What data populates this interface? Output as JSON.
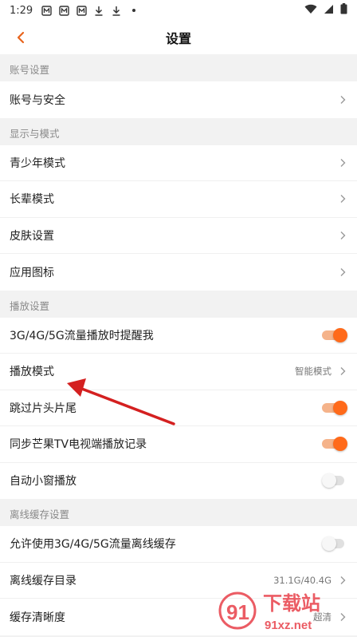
{
  "status_bar": {
    "time": "1:29"
  },
  "nav": {
    "title": "设置"
  },
  "sections": {
    "account": {
      "header": "账号设置",
      "account_security": "账号与安全"
    },
    "display": {
      "header": "显示与模式",
      "teen_mode": "青少年模式",
      "elder_mode": "长辈模式",
      "skin": "皮肤设置",
      "app_icon": "应用图标"
    },
    "playback": {
      "header": "播放设置",
      "mobile_data_remind": "3G/4G/5G流量播放时提醒我",
      "play_mode": "播放模式",
      "play_mode_value": "智能模式",
      "skip_intro": "跳过片头片尾",
      "sync_tv": "同步芒果TV电视端播放记录",
      "auto_mini": "自动小窗播放"
    },
    "offline": {
      "header": "离线缓存设置",
      "allow_mobile_cache": "允许使用3G/4G/5G流量离线缓存",
      "cache_dir": "离线缓存目录",
      "cache_dir_value": "31.1G/40.4G",
      "cache_quality": "缓存清晰度",
      "cache_quality_value": "超清"
    }
  },
  "toggles": {
    "mobile_data_remind": true,
    "skip_intro": true,
    "sync_tv": true,
    "auto_mini": false,
    "allow_mobile_cache": false
  },
  "watermark": {
    "text": "下载站",
    "url": "91xz.net",
    "digits": "91"
  },
  "colors": {
    "accent": "#ff6a1a",
    "toggle_track_on": "#f5b38a",
    "back_arrow": "#e8641c",
    "annotation_arrow": "#d42020"
  }
}
